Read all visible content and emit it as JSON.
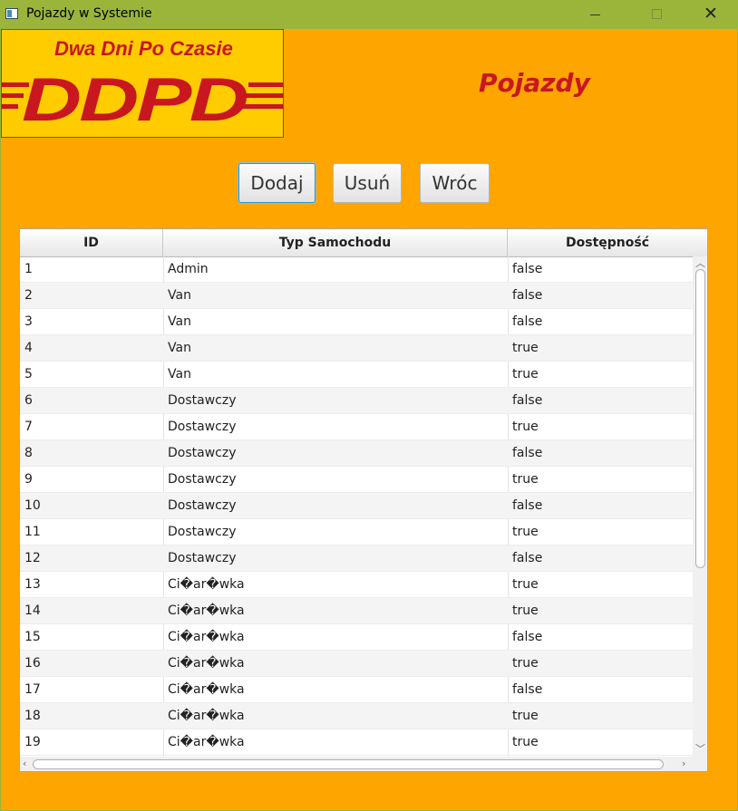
{
  "window": {
    "title": "Pojazdy w Systemie"
  },
  "logo": {
    "tagline": "Dwa Dni Po Czasie",
    "mark": "DDPD"
  },
  "page": {
    "title": "Pojazdy"
  },
  "buttons": {
    "add": "Dodaj",
    "remove": "Usuń",
    "back": "Wróc"
  },
  "table": {
    "columns": [
      "ID",
      "Typ Samochodu",
      "Dostępność"
    ],
    "rows": [
      {
        "id": "1",
        "type": "Admin",
        "available": "false"
      },
      {
        "id": "2",
        "type": "Van",
        "available": "false"
      },
      {
        "id": "3",
        "type": "Van",
        "available": "false"
      },
      {
        "id": "4",
        "type": "Van",
        "available": "true"
      },
      {
        "id": "5",
        "type": "Van",
        "available": "true"
      },
      {
        "id": "6",
        "type": "Dostawczy",
        "available": "false"
      },
      {
        "id": "7",
        "type": "Dostawczy",
        "available": "true"
      },
      {
        "id": "8",
        "type": "Dostawczy",
        "available": "false"
      },
      {
        "id": "9",
        "type": "Dostawczy",
        "available": "true"
      },
      {
        "id": "10",
        "type": "Dostawczy",
        "available": "false"
      },
      {
        "id": "11",
        "type": "Dostawczy",
        "available": "true"
      },
      {
        "id": "12",
        "type": "Dostawczy",
        "available": "false"
      },
      {
        "id": "13",
        "type": "Ci�ar�wka",
        "available": "true"
      },
      {
        "id": "14",
        "type": "Ci�ar�wka",
        "available": "true"
      },
      {
        "id": "15",
        "type": "Ci�ar�wka",
        "available": "false"
      },
      {
        "id": "16",
        "type": "Ci�ar�wka",
        "available": "true"
      },
      {
        "id": "17",
        "type": "Ci�ar�wka",
        "available": "false"
      },
      {
        "id": "18",
        "type": "Ci�ar�wka",
        "available": "true"
      },
      {
        "id": "19",
        "type": "Ci�ar�wka",
        "available": "true"
      }
    ]
  },
  "colors": {
    "titlebar": "#9bb53a",
    "background": "#ffa500",
    "logo_bg": "#ffcc00",
    "brand_red": "#c8171e"
  }
}
